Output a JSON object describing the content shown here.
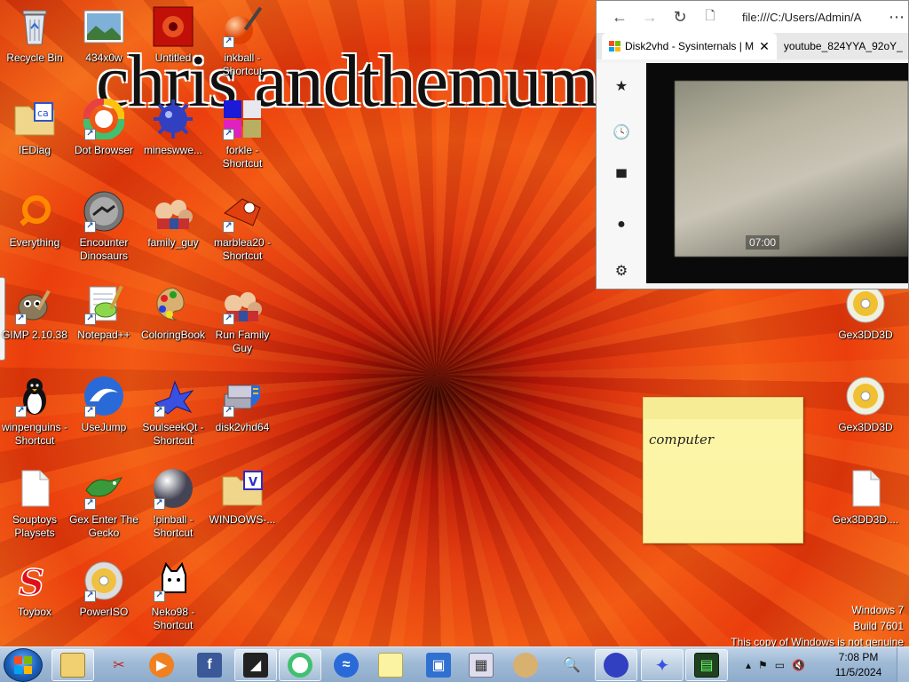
{
  "wallpaper": {
    "text": "chris andthemum"
  },
  "desktop_icons": [
    {
      "label": "Recycle Bin",
      "icon": "recycle-bin-icon",
      "shortcut": false
    },
    {
      "label": "434x0w",
      "icon": "image-icon",
      "shortcut": false
    },
    {
      "label": "Untitled",
      "icon": "image-icon",
      "shortcut": false
    },
    {
      "label": "inkball - Shortcut",
      "icon": "inkball-icon",
      "shortcut": true
    },
    {
      "label": "IEDiag",
      "icon": "folder-icon",
      "shortcut": false
    },
    {
      "label": "Dot Browser",
      "icon": "dot-browser-icon",
      "shortcut": true
    },
    {
      "label": "mineswwe...",
      "icon": "minesweeper-icon",
      "shortcut": false
    },
    {
      "label": "forkle - Shortcut",
      "icon": "forkle-icon",
      "shortcut": true
    },
    {
      "label": "Everything",
      "icon": "everything-icon",
      "shortcut": false
    },
    {
      "label": "Encounter Dinosaurs",
      "icon": "dinosaur-icon",
      "shortcut": true
    },
    {
      "label": "family_guy",
      "icon": "family-guy-icon",
      "shortcut": false
    },
    {
      "label": "marblea20 - Shortcut",
      "icon": "marble-icon",
      "shortcut": true
    },
    {
      "label": "GIMP 2.10.38",
      "icon": "gimp-icon",
      "shortcut": true
    },
    {
      "label": "Notepad++",
      "icon": "notepad-plus-icon",
      "shortcut": true
    },
    {
      "label": "ColoringBook",
      "icon": "palette-icon",
      "shortcut": false
    },
    {
      "label": "Run Family Guy",
      "icon": "family-guy-icon",
      "shortcut": true
    },
    {
      "label": "winpenguins - Shortcut",
      "icon": "penguin-icon",
      "shortcut": true
    },
    {
      "label": "UseJump",
      "icon": "usejump-icon",
      "shortcut": true
    },
    {
      "label": "SoulseekQt - Shortcut",
      "icon": "soulseek-icon",
      "shortcut": true
    },
    {
      "label": "disk2vhd64",
      "icon": "disk2vhd-icon",
      "shortcut": true
    },
    {
      "label": "Souptoys Playsets",
      "icon": "document-icon",
      "shortcut": false
    },
    {
      "label": "Gex Enter The Gecko",
      "icon": "gecko-icon",
      "shortcut": true
    },
    {
      "label": "!pinball - Shortcut",
      "icon": "pinball-icon",
      "shortcut": true
    },
    {
      "label": "WINDOWS-...",
      "icon": "folder-icon",
      "shortcut": false
    },
    {
      "label": "Toybox",
      "icon": "toybox-icon",
      "shortcut": false
    },
    {
      "label": "PowerISO",
      "icon": "poweriso-icon",
      "shortcut": true
    },
    {
      "label": "Neko98 - Shortcut",
      "icon": "neko-icon",
      "shortcut": true
    },
    {
      "label": "Gex3DD3D",
      "icon": "disc-icon",
      "shortcut": false
    },
    {
      "label": "Gex3DD3D",
      "icon": "disc-icon",
      "shortcut": false
    },
    {
      "label": "Gex3DD3D....",
      "icon": "document-icon",
      "shortcut": false
    }
  ],
  "browser": {
    "url": "file:///C:/Users/Admin/A",
    "tabs": [
      {
        "title": "Disk2vhd - Sysinternals | M",
        "active": true
      },
      {
        "title": "youtube_824YYA_92oY_",
        "active": false
      }
    ],
    "video_time": "07:00"
  },
  "sticky_note": {
    "text": "computer"
  },
  "watermark": {
    "line1": "Windows 7",
    "line2": "Build 7601",
    "line3": "This copy of Windows is not genuine"
  },
  "taskbar": {
    "clock_time": "7:08 PM",
    "clock_date": "11/5/2024",
    "pinned": [
      "explorer-icon",
      "snipping-tool-icon",
      "media-player-icon",
      "facebook-icon",
      "media-app-icon",
      "dot-browser-icon",
      "usejump-icon",
      "sticky-notes-icon",
      "network-icon",
      "calculator-icon",
      "paint-icon",
      "magnifier-icon",
      "minesweeper-icon",
      "soulseek-icon",
      "terminal-icon"
    ]
  },
  "colors": {
    "taskbar": "#9fbad6",
    "sticky": "#fbf2a2",
    "wallpaper": "#e83a0c"
  }
}
